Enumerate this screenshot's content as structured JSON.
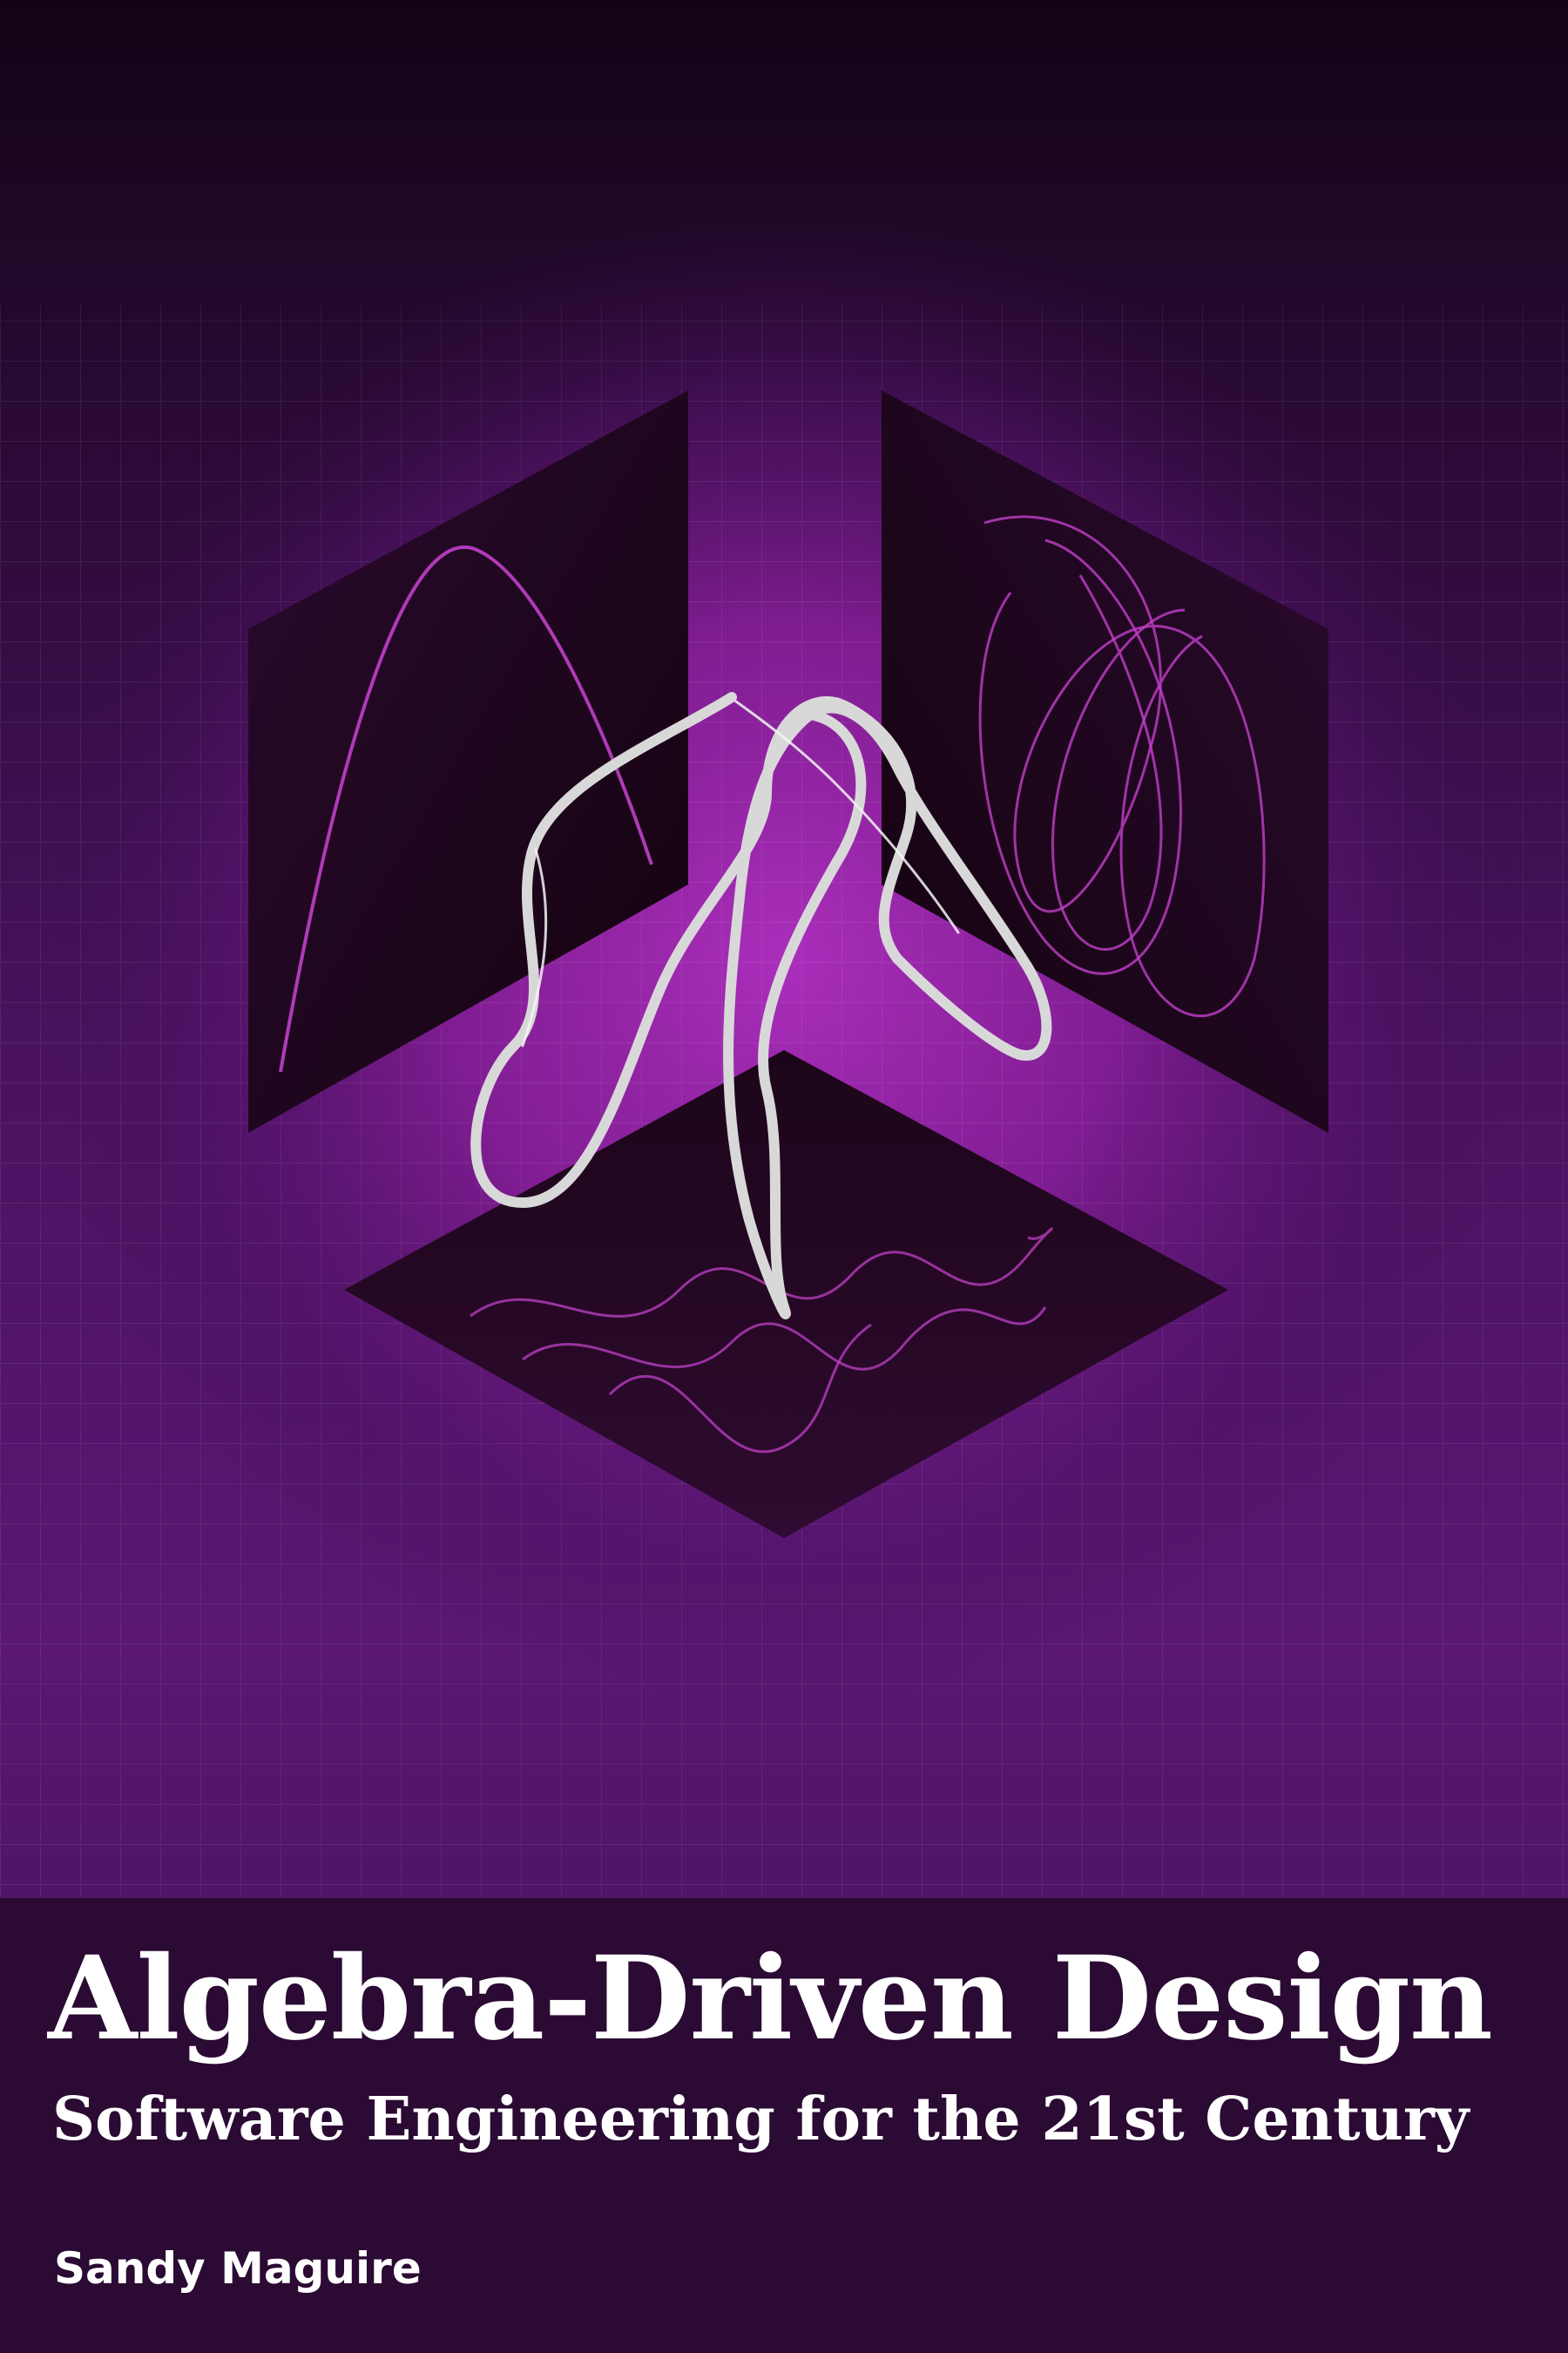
{
  "cover": {
    "title": "Algebra-Driven Design",
    "subtitle": "Software Engineering for the 21st Century",
    "author": "Sandy Maguire"
  },
  "colors": {
    "background_dark": "#1a0620",
    "purple_mid": "#5a1872",
    "magenta_glow": "#a02ab0",
    "panel_dark": "#1e0620",
    "curve_magenta": "#c040c8",
    "ribbon_silver": "#d8d8d8",
    "title_band": "#2b0a33",
    "text": "#ffffff"
  },
  "illustration": {
    "icons": [
      "isometric-cube-outline",
      "parabola-curve",
      "lissajous-curve",
      "wavy-curve",
      "silver-3d-ribbon"
    ]
  }
}
